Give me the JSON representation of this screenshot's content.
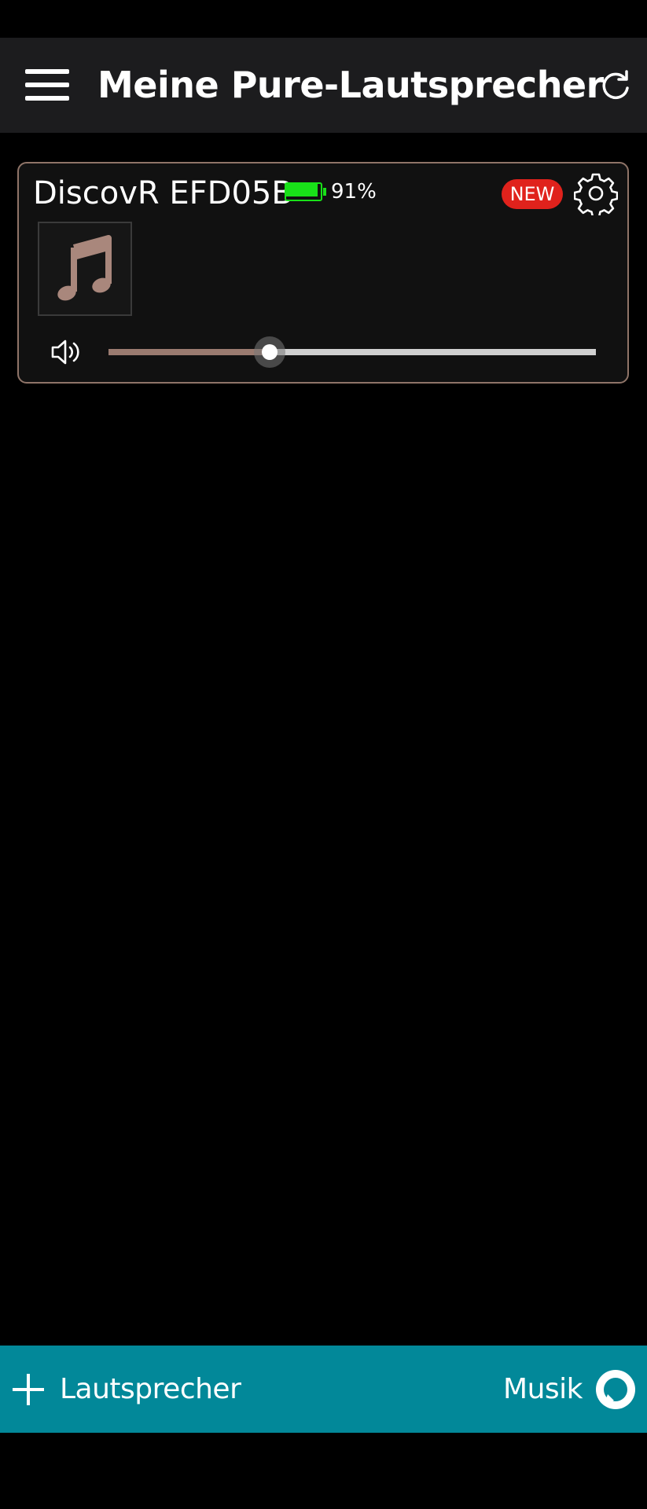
{
  "header": {
    "title": "Meine Pure-Lautsprecher",
    "menu_icon": "hamburger-menu-icon",
    "refresh_icon": "refresh-icon"
  },
  "speakers": [
    {
      "name": "DiscovR EFD05B",
      "battery_percent": 91,
      "battery_label": "91%",
      "badge": "NEW",
      "volume_fraction": 0.33,
      "settings_icon": "gear-icon",
      "album_art_icon": "music-note-icon",
      "volume_icon": "speaker-volume-icon"
    }
  ],
  "bottom_bar": {
    "add_speaker_label": "Lautsprecher",
    "music_label": "Musik",
    "add_icon": "plus-icon",
    "alexa_icon": "alexa-ring-icon"
  },
  "colors": {
    "app_bar_bg": "#1c1c1e",
    "card_border": "#8f7468",
    "battery_green": "#19e019",
    "badge_red": "#e0221c",
    "slider_fill": "#9a7b70",
    "bottom_bar_bg": "#028899",
    "music_note": "#a9877c"
  }
}
